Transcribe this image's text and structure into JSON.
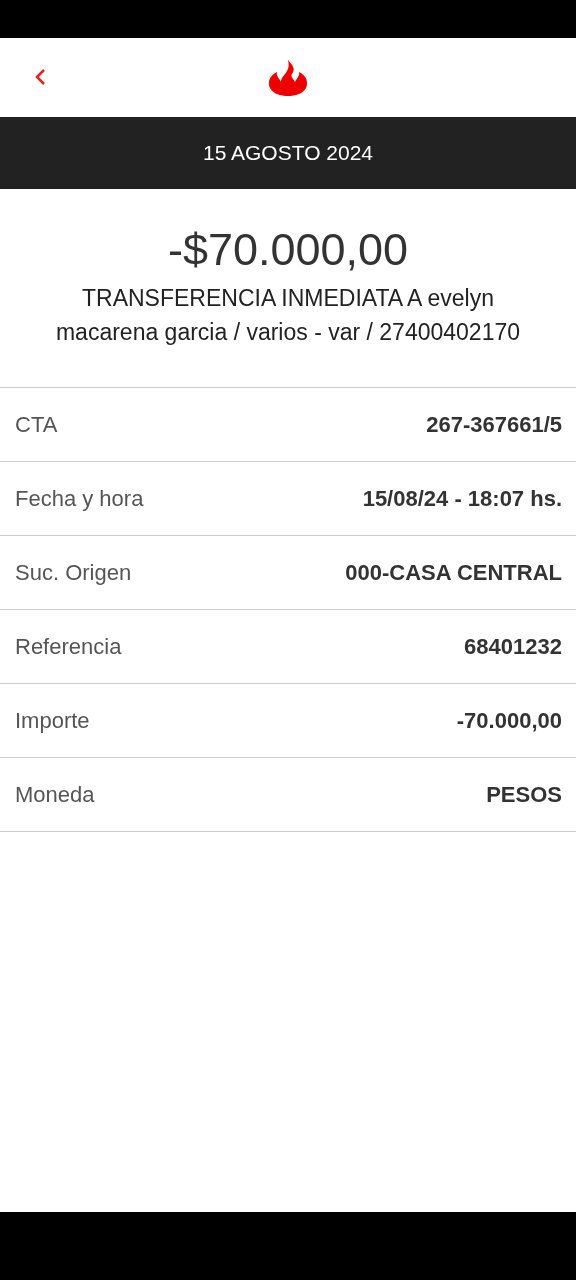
{
  "date_bar": {
    "title": "15 AGOSTO 2024"
  },
  "transaction": {
    "amount": "-$70.000,00",
    "description": "TRANSFERENCIA INMEDIATA A evelyn macarena garcia / varios - var / 27400402170"
  },
  "details": [
    {
      "label": "CTA",
      "value": "267-367661/5"
    },
    {
      "label": "Fecha y hora",
      "value": "15/08/24 - 18:07 hs."
    },
    {
      "label": "Suc. Origen",
      "value": "000-CASA CENTRAL"
    },
    {
      "label": "Referencia",
      "value": "68401232"
    },
    {
      "label": "Importe",
      "value": "-70.000,00"
    },
    {
      "label": "Moneda",
      "value": "PESOS"
    }
  ]
}
